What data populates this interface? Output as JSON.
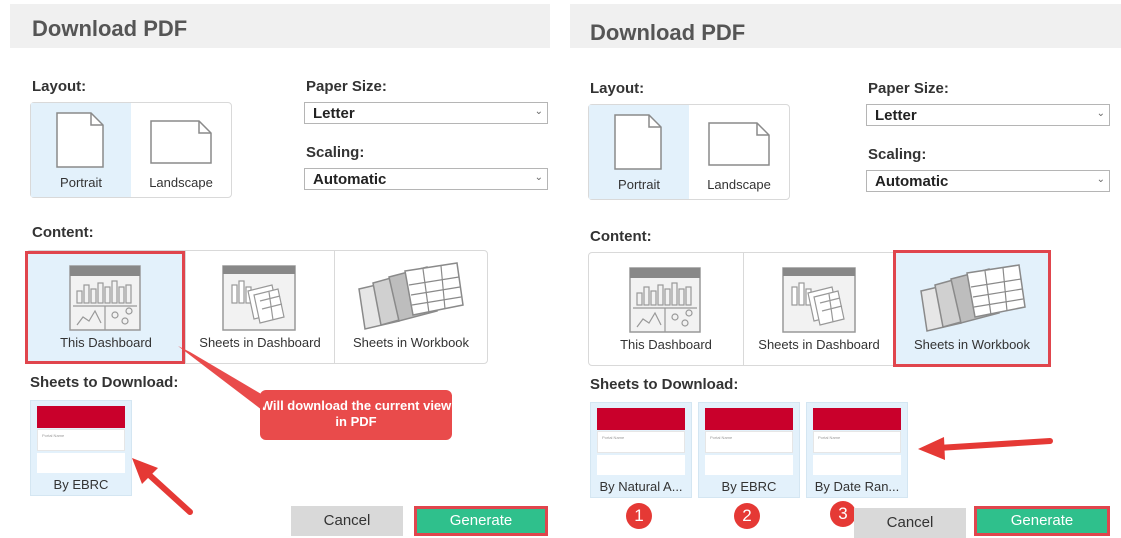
{
  "left": {
    "title": "Download PDF",
    "layout_label": "Layout:",
    "portrait": "Portrait",
    "landscape": "Landscape",
    "paper_size_label": "Paper Size:",
    "paper_size_value": "Letter",
    "scaling_label": "Scaling:",
    "scaling_value": "Automatic",
    "content_label": "Content:",
    "content_options": [
      "This Dashboard",
      "Sheets in Dashboard",
      "Sheets in Workbook"
    ],
    "selected_content": "This Dashboard",
    "sheets_label": "Sheets to Download:",
    "sheets": [
      "By EBRC"
    ],
    "callout": "Will download the current view in PDF",
    "cancel": "Cancel",
    "generate": "Generate"
  },
  "right": {
    "title": "Download PDF",
    "layout_label": "Layout:",
    "portrait": "Portrait",
    "landscape": "Landscape",
    "paper_size_label": "Paper Size:",
    "paper_size_value": "Letter",
    "scaling_label": "Scaling:",
    "scaling_value": "Automatic",
    "content_label": "Content:",
    "content_options": [
      "This Dashboard",
      "Sheets in Dashboard",
      "Sheets in Workbook"
    ],
    "selected_content": "Sheets in Workbook",
    "sheets_label": "Sheets to Download:",
    "sheets": [
      "By Natural A...",
      "By EBRC",
      "By Date Ran..."
    ],
    "badges": [
      "1",
      "2",
      "3"
    ],
    "cancel": "Cancel",
    "generate": "Generate"
  },
  "thumb_text": [
    "Portal Name",
    "Name"
  ],
  "colors": {
    "accent_red": "#e0454d",
    "generate_green": "#2fc08c",
    "selected_bg": "#e3f1fb",
    "thumb_red": "#c9002b"
  },
  "icons": [
    "page-portrait-icon",
    "page-landscape-icon",
    "dashboard-icon",
    "sheets-in-dashboard-icon",
    "sheets-in-workbook-icon",
    "arrow-annotation-icon"
  ]
}
